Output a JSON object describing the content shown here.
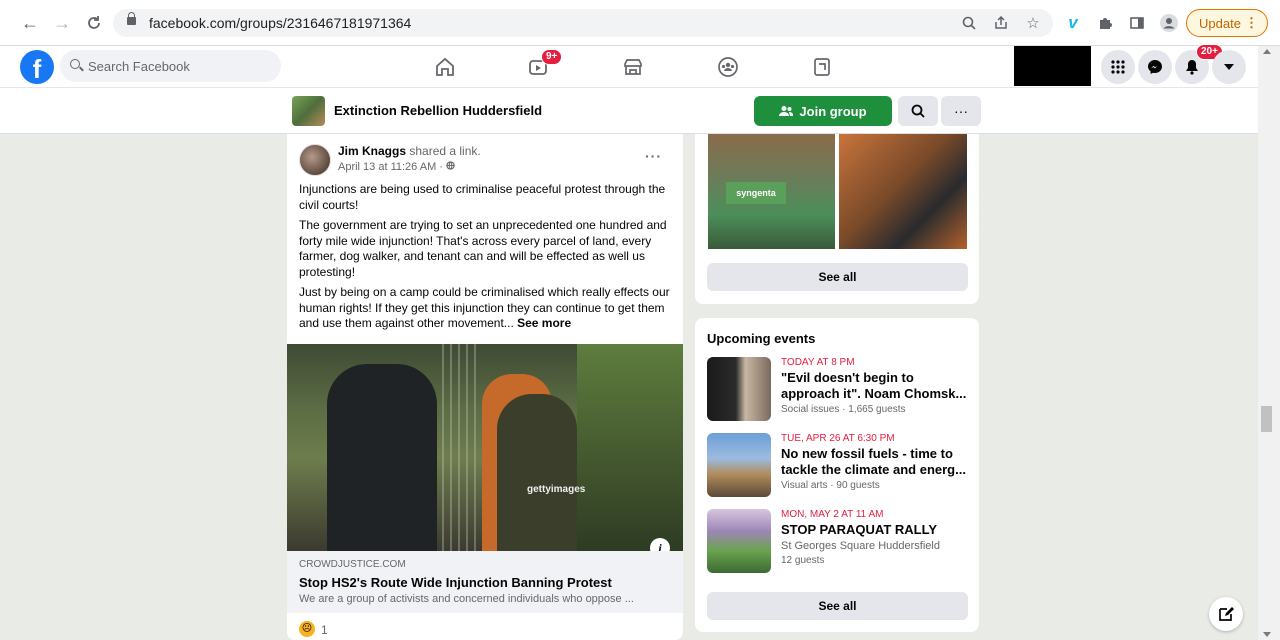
{
  "browser": {
    "url": "facebook.com/groups/2316467181971364",
    "update_label": "Update"
  },
  "facebook": {
    "logo_letter": "f",
    "search_placeholder": "Search Facebook",
    "watch_badge": "9+",
    "notifications_badge": "20+"
  },
  "group": {
    "name": "Extinction Rebellion Huddersfield",
    "join_label": "Join group",
    "more_label": "···"
  },
  "post": {
    "author": "Jim Knaggs",
    "action": " shared a link.",
    "time": "April 13 at 11:26 AM · ",
    "paragraphs": [
      "Injunctions are being used to criminalise peaceful protest through the civil courts!",
      "The government are trying to set an unprecedented one hundred and forty mile wide injunction! That's across every parcel of land, every farmer, dog walker, and tenant can and will be effected as well us protesting!",
      "Just by being on a camp could be criminalised which really effects our human rights! If they get this injunction they can continue to get them and use them against other movement... "
    ],
    "see_more": "See more",
    "image_watermark": "gettyimages",
    "link_domain": "CROWDJUSTICE.COM",
    "link_title": "Stop HS2's Route Wide Injunction Banning Protest",
    "link_desc": "We are a group of activists and concerned individuals who oppose ...",
    "reaction_count": "1"
  },
  "media": {
    "sign_text": "syngenta",
    "see_all": "See all"
  },
  "events": {
    "title": "Upcoming events",
    "items": [
      {
        "date": "TODAY AT 8 PM",
        "title": "\"Evil doesn't begin to approach it\". Noam Chomsk...",
        "meta": "Social issues · 1,665 guests"
      },
      {
        "date": "TUE, APR 26 AT 6:30 PM",
        "title": "No new fossil fuels - time to tackle the climate and energ...",
        "meta": "Visual arts · 90 guests"
      },
      {
        "date": "MON, MAY 2 AT 11 AM",
        "title": "STOP PARAQUAT RALLY",
        "location": "St Georges Square Huddersfield",
        "meta": "12 guests"
      }
    ],
    "see_all": "See all"
  },
  "colors": {
    "facebook_blue": "#1877f2",
    "join_green": "#1e8f3d",
    "badge_red": "#e41e3f",
    "page_bg": "#e9ece6"
  }
}
